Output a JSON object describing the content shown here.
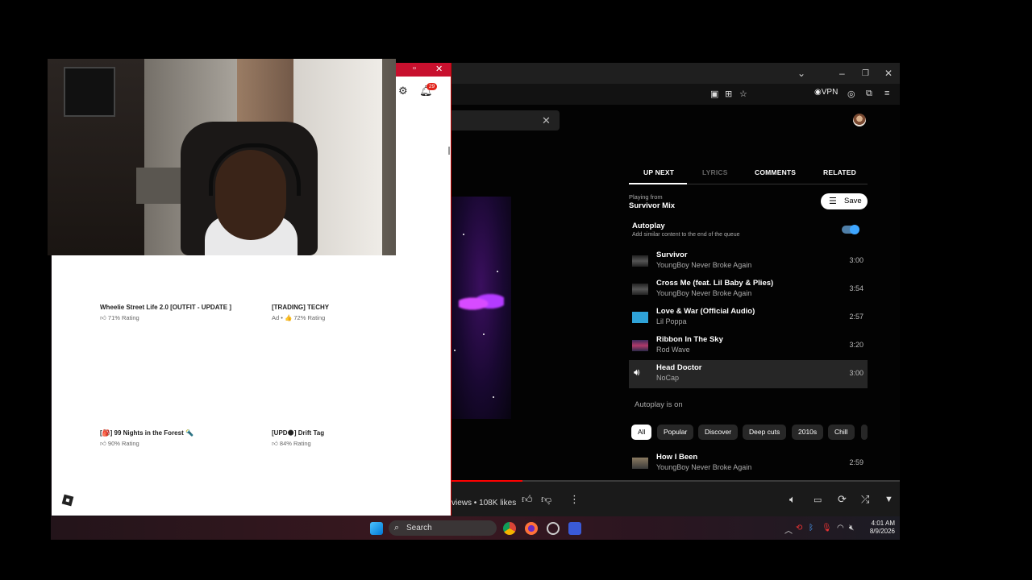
{
  "youtube_music": {
    "tabs": [
      {
        "label": "UP NEXT",
        "active": true
      },
      {
        "label": "LYRICS",
        "active": false
      },
      {
        "label": "COMMENTS",
        "active": false
      },
      {
        "label": "RELATED",
        "active": false
      }
    ],
    "playing_from_label": "Playing from",
    "playing_from_value": "Survivor Mix",
    "save_label": "Save",
    "autoplay_title": "Autoplay",
    "autoplay_subtitle": "Add similar content to the end of the queue",
    "autoplay_enabled": true,
    "queue": [
      {
        "title": "Survivor",
        "artist": "YoungBoy Never Broke Again",
        "duration": "3:00"
      },
      {
        "title": "Cross Me (feat. Lil Baby & Plies)",
        "artist": "YoungBoy Never Broke Again",
        "duration": "3:54"
      },
      {
        "title": "Love & War (Official Audio)",
        "artist": "Lil Poppa",
        "duration": "2:57"
      },
      {
        "title": "Ribbon In The Sky",
        "artist": "Rod Wave",
        "duration": "3:20"
      },
      {
        "title": "Head Doctor",
        "artist": "NoCap",
        "duration": "3:00",
        "playing": true
      }
    ],
    "autoplay_on_label": "Autoplay is on",
    "chips": [
      "All",
      "Popular",
      "Discover",
      "Deep cuts",
      "2010s",
      "Chill"
    ],
    "autoplay_queue": [
      {
        "title": "How I Been",
        "artist": "YoungBoy Never Broke Again",
        "duration": "2:59"
      }
    ],
    "views_likes": "views • 108K likes",
    "toolbar": {
      "vpn": "VPN"
    }
  },
  "roblox": {
    "notification_count": "29",
    "games": [
      {
        "title": "Wheelie Street Life 2.0 [OUTFIT - UPDATE ]",
        "rating": "71% Rating"
      },
      {
        "title": "[TRADING] TECHY",
        "rating": "Ad • 👍 72% Rating"
      },
      {
        "title": "[🎒] 99 Nights in the Forest 🔦",
        "rating": "90% Rating"
      },
      {
        "title": "[UPD🌑] Drift Tag",
        "rating": "84% Rating"
      }
    ]
  },
  "taskbar": {
    "search_label": "Search",
    "time": "4:01 AM",
    "date": "8/9/2026"
  },
  "colors": {
    "roblox_red": "#c8102e",
    "ytm_accent": "#3ea6ff",
    "progress": "#ff0000"
  }
}
